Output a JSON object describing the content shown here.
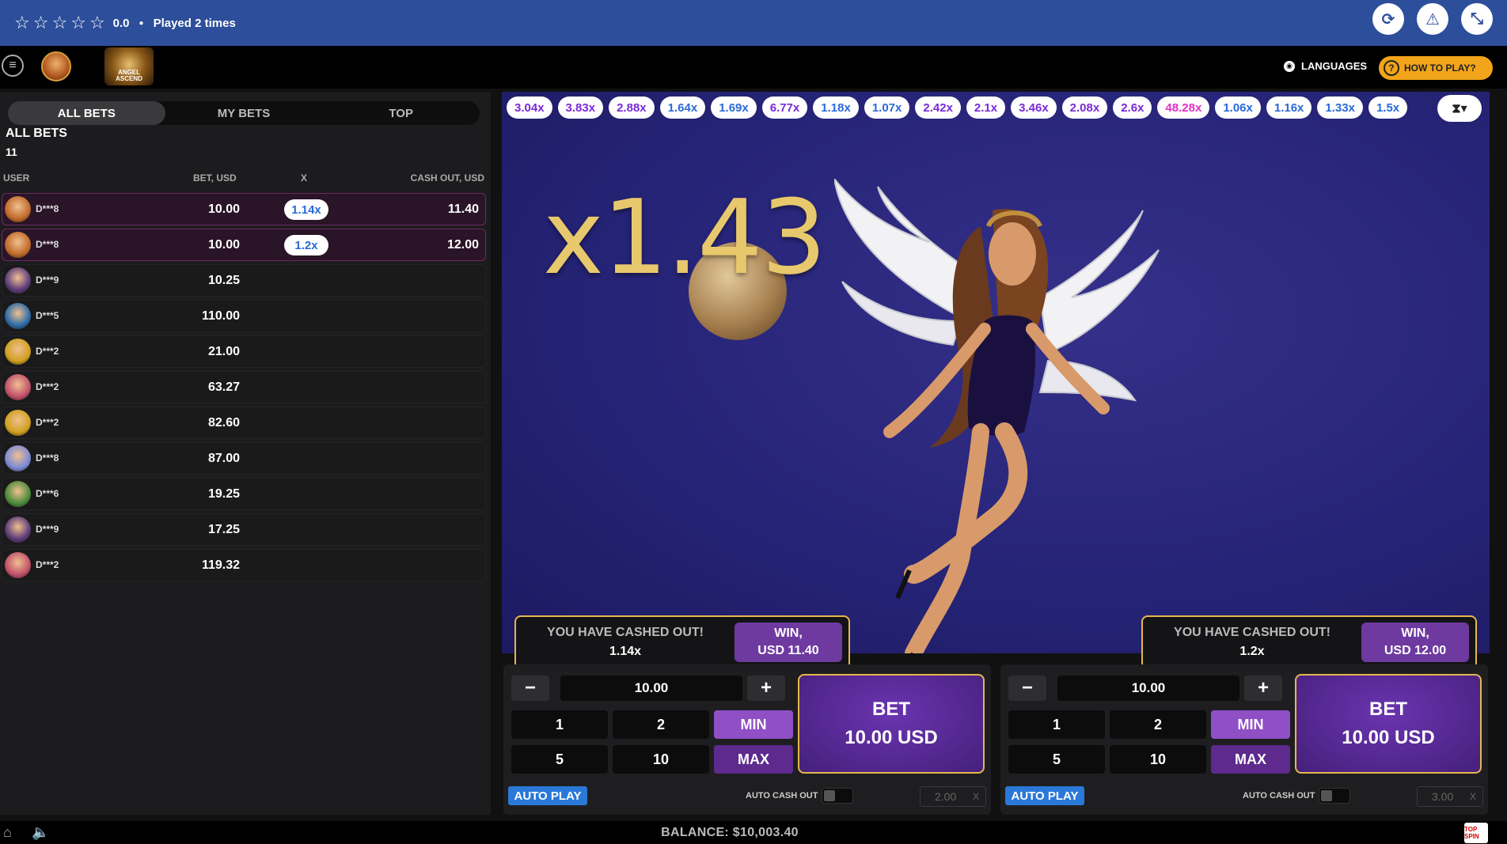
{
  "topbar": {
    "rating": "0.0",
    "played": "Played 2 times"
  },
  "header": {
    "languages": "LANGUAGES",
    "how_to_play": "HOW TO PLAY?",
    "logo_text": "ANGEL ASCEND"
  },
  "tabs": [
    "ALL BETS",
    "MY BETS",
    "TOP"
  ],
  "bets": {
    "title": "ALL BETS",
    "count": "11",
    "columns": [
      "USER",
      "BET, USD",
      "X",
      "CASH OUT, USD"
    ],
    "rows": [
      {
        "user": "D***8",
        "bet": "10.00",
        "x": "1.14x",
        "cashout": "11.40",
        "win": true,
        "color": "#c06a2a"
      },
      {
        "user": "D***8",
        "bet": "10.00",
        "x": "1.2x",
        "cashout": "12.00",
        "win": true,
        "color": "#c06a2a"
      },
      {
        "user": "D***9",
        "bet": "10.25",
        "x": "",
        "cashout": "",
        "win": false,
        "color": "#5a3a7a"
      },
      {
        "user": "D***5",
        "bet": "110.00",
        "x": "",
        "cashout": "",
        "win": false,
        "color": "#2a6aa8"
      },
      {
        "user": "D***2",
        "bet": "21.00",
        "x": "",
        "cashout": "",
        "win": false,
        "color": "#d0a020"
      },
      {
        "user": "D***2",
        "bet": "63.27",
        "x": "",
        "cashout": "",
        "win": false,
        "color": "#c0506a"
      },
      {
        "user": "D***2",
        "bet": "82.60",
        "x": "",
        "cashout": "",
        "win": false,
        "color": "#d0a020"
      },
      {
        "user": "D***8",
        "bet": "87.00",
        "x": "",
        "cashout": "",
        "win": false,
        "color": "#7a8ad8"
      },
      {
        "user": "D***6",
        "bet": "19.25",
        "x": "",
        "cashout": "",
        "win": false,
        "color": "#4a8a3a"
      },
      {
        "user": "D***9",
        "bet": "17.25",
        "x": "",
        "cashout": "",
        "win": false,
        "color": "#5a3a7a"
      },
      {
        "user": "D***2",
        "bet": "119.32",
        "x": "",
        "cashout": "",
        "win": false,
        "color": "#c0506a"
      }
    ]
  },
  "multipliers": [
    {
      "v": "3.04x",
      "c": "#7a2ad8"
    },
    {
      "v": "3.83x",
      "c": "#7a2ad8"
    },
    {
      "v": "2.88x",
      "c": "#7a2ad8"
    },
    {
      "v": "1.64x",
      "c": "#2a6ad8"
    },
    {
      "v": "1.69x",
      "c": "#2a6ad8"
    },
    {
      "v": "6.77x",
      "c": "#7a2ad8"
    },
    {
      "v": "1.18x",
      "c": "#2a6ad8"
    },
    {
      "v": "1.07x",
      "c": "#2a6ad8"
    },
    {
      "v": "2.42x",
      "c": "#7a2ad8"
    },
    {
      "v": "2.1x",
      "c": "#7a2ad8"
    },
    {
      "v": "3.46x",
      "c": "#7a2ad8"
    },
    {
      "v": "2.08x",
      "c": "#7a2ad8"
    },
    {
      "v": "2.6x",
      "c": "#7a2ad8"
    },
    {
      "v": "48.28x",
      "c": "#e030c8"
    },
    {
      "v": "1.06x",
      "c": "#2a6ad8"
    },
    {
      "v": "1.16x",
      "c": "#2a6ad8"
    },
    {
      "v": "1.33x",
      "c": "#2a6ad8"
    },
    {
      "v": "1.5x",
      "c": "#2a6ad8"
    }
  ],
  "game": {
    "current_multiplier": "x1.43"
  },
  "cashouts": [
    {
      "msg": "YOU HAVE CASHED OUT!",
      "mult": "1.14x",
      "win_label": "WIN,",
      "win_amount": "USD 11.40"
    },
    {
      "msg": "YOU HAVE CASHED OUT!",
      "mult": "1.2x",
      "win_label": "WIN,",
      "win_amount": "USD 12.00"
    }
  ],
  "panels": [
    {
      "amount": "10.00",
      "q1": "1",
      "q2": "2",
      "q5": "5",
      "q10": "10",
      "min": "MIN",
      "max": "MAX",
      "bet_label": "BET",
      "bet_amount": "10.00 USD",
      "auto_play": "AUTO PLAY",
      "auto_cash_out": "AUTO CASH OUT",
      "auto_value": "2.00",
      "x": "X"
    },
    {
      "amount": "10.00",
      "q1": "1",
      "q2": "2",
      "q5": "5",
      "q10": "10",
      "min": "MIN",
      "max": "MAX",
      "bet_label": "BET",
      "bet_amount": "10.00 USD",
      "auto_play": "AUTO PLAY",
      "auto_cash_out": "AUTO CASH OUT",
      "auto_value": "3.00",
      "x": "X"
    }
  ],
  "footer": {
    "balance": "BALANCE: $10,003.40",
    "brand": "TOP SPIN"
  },
  "colors": {
    "topbar": "#2d4e9a",
    "gold": "#e5b650",
    "purple": "#6e3aa0",
    "blue": "#2a78d8"
  }
}
